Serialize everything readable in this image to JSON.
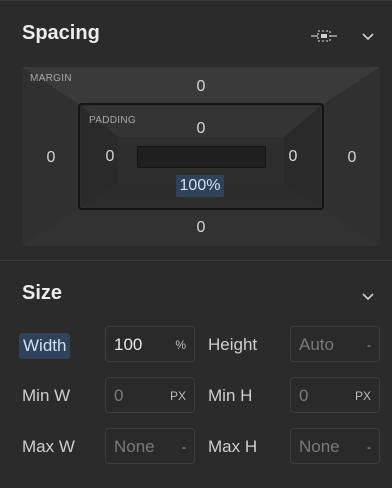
{
  "spacing": {
    "title": "Spacing",
    "margin_label": "MARGIN",
    "padding_label": "PADDING",
    "margin": {
      "top": "0",
      "right": "0",
      "bottom": "0",
      "left": "0"
    },
    "padding": {
      "top": "0",
      "right": "0",
      "left": "0"
    },
    "content_width": "100%"
  },
  "size": {
    "title": "Size",
    "fields": {
      "width": {
        "label": "Width",
        "value": "100",
        "unit": "%"
      },
      "height": {
        "label": "Height",
        "value": "Auto",
        "unit": "-"
      },
      "min_w": {
        "label": "Min W",
        "value": "0",
        "unit": "PX"
      },
      "min_h": {
        "label": "Min H",
        "value": "0",
        "unit": "PX"
      },
      "max_w": {
        "label": "Max W",
        "value": "None",
        "unit": "-"
      },
      "max_h": {
        "label": "Max H",
        "value": "None",
        "unit": "-"
      }
    }
  },
  "icons": {
    "align": "align-center-icon",
    "chevron": "chevron-down-icon"
  },
  "colors": {
    "panel": "#2b2b2b",
    "active_highlight": "#2f4257"
  }
}
